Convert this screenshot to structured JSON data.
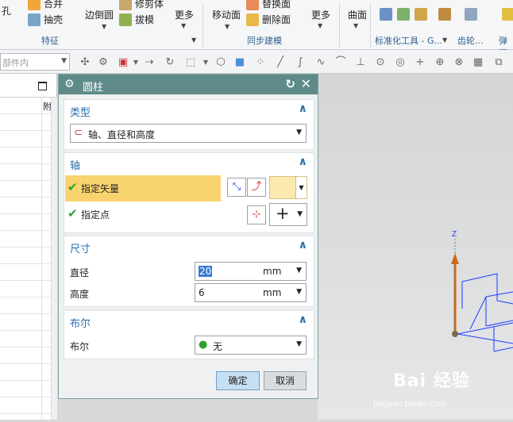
{
  "ribbon": {
    "row1": {
      "hole": "孔",
      "combine": "合并",
      "trim_body": "修剪体"
    },
    "row2": {
      "shell": "抽壳",
      "edge_blend": "边倒圆",
      "draft": "拔模"
    },
    "more1": "更多",
    "feature_group": "特征",
    "move_face": "移动面",
    "replace_face": "替换面",
    "delete_face": "删除面",
    "more2": "更多",
    "surface": "曲面",
    "sync_group": "同步建模",
    "std_tools_group": "标准化工具 - G...",
    "gear_group": "齿轮...",
    "spring_group": "弹簧"
  },
  "toolbar": {
    "filter_placeholder": "部件内"
  },
  "leftnav": {
    "col_header": "附"
  },
  "dialog": {
    "title": "圆柱",
    "type_section": {
      "title": "类型",
      "value": "轴、直径和高度"
    },
    "axis_section": {
      "title": "轴",
      "specify_vector": "指定矢量",
      "specify_point": "指定点"
    },
    "dim_section": {
      "title": "尺寸",
      "diameter_label": "直径",
      "diameter_value": "20",
      "diameter_unit": "mm",
      "height_label": "高度",
      "height_value": "6",
      "height_unit": "mm"
    },
    "bool_section": {
      "title": "布尔",
      "label": "布尔",
      "value": "无"
    },
    "ok": "确定",
    "cancel": "取消"
  },
  "viewport": {
    "axis_label": "Z",
    "axis_color": "#c86a1e",
    "wire_color": "#1e3cff"
  },
  "watermark": {
    "brand": "Bai 经验",
    "url": "jingyan.baidu.com"
  },
  "colors": {
    "title_bar": "#5e8a8a",
    "section_title": "#2a6eae",
    "highlight": "#f8d36e"
  }
}
